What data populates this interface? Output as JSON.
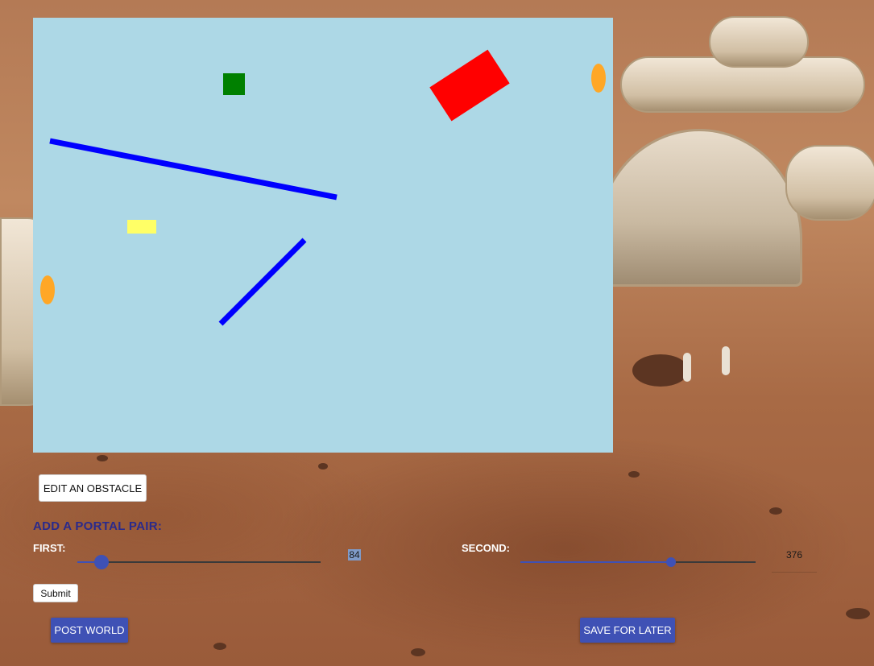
{
  "canvas": {
    "background": "#add8e6",
    "obstacles": [
      {
        "kind": "rect",
        "name": "green-block",
        "color": "#008000"
      },
      {
        "kind": "rect",
        "name": "red-block",
        "color": "#ff0000"
      },
      {
        "kind": "rect",
        "name": "yellow-block",
        "color": "#ffff66"
      },
      {
        "kind": "line",
        "name": "blue-line-1",
        "color": "#0000ff"
      },
      {
        "kind": "line",
        "name": "blue-line-2",
        "color": "#0000ff"
      }
    ],
    "portal_color": "#ffa726"
  },
  "toolbar": {
    "edit_obstacle_label": "EDIT AN OBSTACLE"
  },
  "portal_form": {
    "heading": "ADD A PORTAL PAIR:",
    "first_label": "FIRST:",
    "first_value": "84",
    "first_fraction": 0.1,
    "second_label": "SECOND:",
    "second_value": "376",
    "second_fraction": 0.64,
    "submit_label": "Submit"
  },
  "actions": {
    "post_world_label": "POST WORLD",
    "save_later_label": "SAVE FOR LATER"
  },
  "colors": {
    "accent": "#3f51b5",
    "heading": "#2a2a8c"
  }
}
